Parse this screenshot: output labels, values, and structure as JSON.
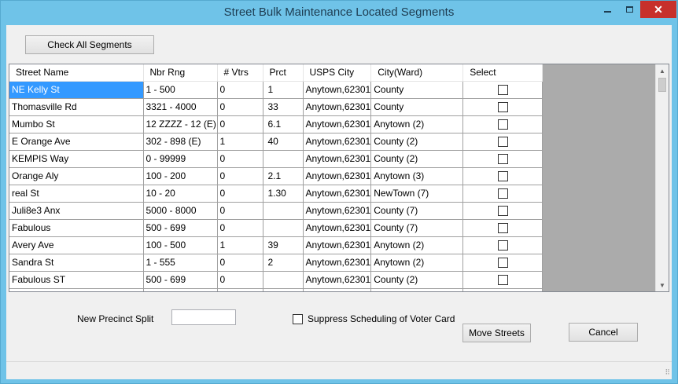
{
  "window": {
    "title": "Street Bulk Maintenance Located Segments",
    "close_glyph": "✕"
  },
  "toolbar": {
    "check_all_label": "Check All Segments"
  },
  "table": {
    "columns": [
      "Street Name",
      "Nbr Rng",
      "# Vtrs",
      "Prct",
      "USPS City",
      "City(Ward)",
      "Select"
    ],
    "rows": [
      {
        "street": "NE Kelly St",
        "range": "1 - 500",
        "voters": "0",
        "prct": "1",
        "usps": "Anytown,62301",
        "ward": "County",
        "selected": true
      },
      {
        "street": "Thomasville Rd",
        "range": "3321 - 4000",
        "voters": "0",
        "prct": "33",
        "usps": "Anytown,62301",
        "ward": "County",
        "selected": false
      },
      {
        "street": "Mumbo St",
        "range": "12 ZZZZ - 12 (E)",
        "voters": "0",
        "prct": "6.1",
        "usps": "Anytown,62301",
        "ward": "Anytown (2)",
        "selected": false
      },
      {
        "street": "E Orange Ave",
        "range": "302 - 898 (E)",
        "voters": "1",
        "prct": "40",
        "usps": "Anytown,62301",
        "ward": "County (2)",
        "selected": false
      },
      {
        "street": "KEMPIS Way",
        "range": "0 - 99999",
        "voters": "0",
        "prct": "",
        "usps": "Anytown,62301",
        "ward": "County (2)",
        "selected": false
      },
      {
        "street": "Orange Aly",
        "range": "100 - 200",
        "voters": "0",
        "prct": "2.1",
        "usps": "Anytown,62301",
        "ward": "Anytown (3)",
        "selected": false
      },
      {
        "street": "real St",
        "range": "10 - 20",
        "voters": "0",
        "prct": "1.30",
        "usps": "Anytown,62301",
        "ward": "NewTown (7)",
        "selected": false
      },
      {
        "street": "Juli8e3 Anx",
        "range": "5000 - 8000",
        "voters": "0",
        "prct": "",
        "usps": "Anytown,62301",
        "ward": "County (7)",
        "selected": false
      },
      {
        "street": "Fabulous",
        "range": "500 - 699",
        "voters": "0",
        "prct": "",
        "usps": "Anytown,62301",
        "ward": "County (7)",
        "selected": false
      },
      {
        "street": "Avery Ave",
        "range": "100 - 500",
        "voters": "1",
        "prct": "39",
        "usps": "Anytown,62301",
        "ward": "Anytown (2)",
        "selected": false
      },
      {
        "street": "Sandra St",
        "range": "1 - 555",
        "voters": "0",
        "prct": "2",
        "usps": "Anytown,62301",
        "ward": "Anytown (2)",
        "selected": false
      },
      {
        "street": "Fabulous ST",
        "range": "500 - 699",
        "voters": "0",
        "prct": "",
        "usps": "Anytown,62301",
        "ward": "County (2)",
        "selected": false
      },
      {
        "street": "",
        "range": "",
        "voters": "",
        "prct": "",
        "usps": "",
        "ward": "",
        "selected": false
      }
    ]
  },
  "form": {
    "new_precinct_label": "New Precinct Split",
    "new_precinct_value": "",
    "suppress_label": "Suppress Scheduling of Voter Card",
    "move_streets_label": "Move Streets",
    "cancel_label": "Cancel"
  },
  "colors": {
    "selection": "#3399ff",
    "frame": "#6fc3e8",
    "close": "#c7302b"
  }
}
